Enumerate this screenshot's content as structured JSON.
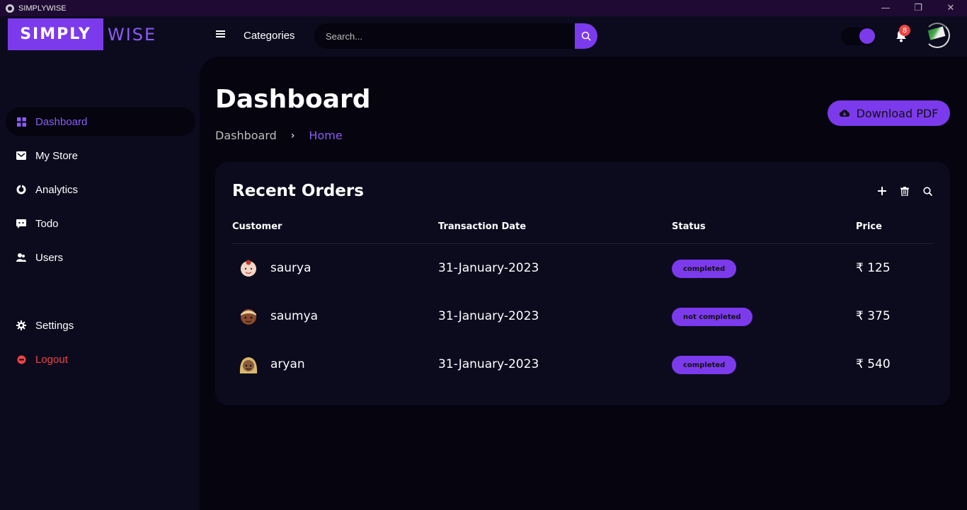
{
  "window": {
    "app_name": "SIMPLYWISE",
    "controls": {
      "minimize": "—",
      "restore": "❐",
      "close": "✕"
    }
  },
  "header": {
    "logo": {
      "part1": "SIMPLY",
      "part2": "WISE"
    },
    "menu_icon": "hamburger-icon",
    "categories_label": "Categories",
    "search": {
      "placeholder": "Search...",
      "value": ""
    },
    "notifications": {
      "count": "8"
    },
    "theme_toggle": "on"
  },
  "sidebar": {
    "items": [
      {
        "label": "Dashboard",
        "icon": "grid-icon",
        "active": true
      },
      {
        "label": "My Store",
        "icon": "store-icon"
      },
      {
        "label": "Analytics",
        "icon": "analytics-icon"
      },
      {
        "label": "Todo",
        "icon": "todo-icon"
      },
      {
        "label": "Users",
        "icon": "users-icon"
      },
      {
        "label": "Settings",
        "icon": "gear-icon"
      },
      {
        "label": "Logout",
        "icon": "logout-icon"
      }
    ]
  },
  "main": {
    "title": "Dashboard",
    "breadcrumb": [
      "Dashboard",
      "Home"
    ],
    "download_label": "Download PDF"
  },
  "orders": {
    "title": "Recent Orders",
    "columns": [
      "Customer",
      "Transaction Date",
      "Status",
      "Price"
    ],
    "rows": [
      {
        "customer": "saurya",
        "date": "31-January-2023",
        "status": "completed",
        "price": "₹ 125"
      },
      {
        "customer": "saumya",
        "date": "31-January-2023",
        "status": "not completed",
        "price": "₹ 375"
      },
      {
        "customer": "aryan",
        "date": "31-January-2023",
        "status": "completed",
        "price": "₹ 540"
      }
    ]
  },
  "colors": {
    "accent": "#7c3aed",
    "danger": "#ef4444",
    "bg": "#0c0b1e",
    "panel": "#05040f"
  }
}
